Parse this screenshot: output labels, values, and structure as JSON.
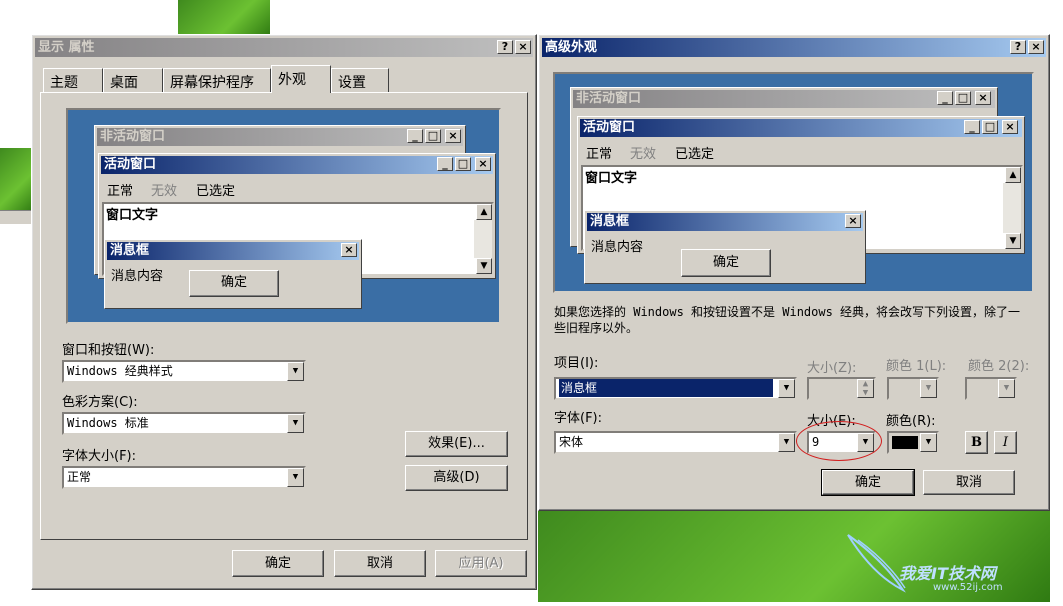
{
  "display_props": {
    "title": "显示 属性",
    "help": "?",
    "close": "×",
    "tabs": [
      "主题",
      "桌面",
      "屏幕保护程序",
      "外观",
      "设置"
    ],
    "preview": {
      "inactive_title": "非活动窗口",
      "active_title": "活动窗口",
      "menu": [
        "正常",
        "无效",
        "已选定"
      ],
      "window_text": "窗口文字",
      "msg_title": "消息框",
      "msg_text": "消息内容",
      "msg_ok": "确定"
    },
    "windows_label": "窗口和按钮(W):",
    "windows_value": "Windows 经典样式",
    "scheme_label": "色彩方案(C):",
    "scheme_value": "Windows 标准",
    "fontsize_label": "字体大小(F):",
    "fontsize_value": "正常",
    "effects_btn": "效果(E)...",
    "advanced_btn": "高级(D)",
    "ok": "确定",
    "cancel": "取消",
    "apply": "应用(A)"
  },
  "advanced": {
    "title": "高级外观",
    "help": "?",
    "close": "×",
    "preview": {
      "inactive_title": "非活动窗口",
      "active_title": "活动窗口",
      "menu": [
        "正常",
        "无效",
        "已选定"
      ],
      "window_text": "窗口文字",
      "msg_title": "消息框",
      "msg_text": "消息内容",
      "msg_ok": "确定"
    },
    "note": "如果您选择的 Windows 和按钮设置不是 Windows 经典，将会改写下列设置，除了一些旧程序以外。",
    "item_label": "项目(I):",
    "item_value": "消息框",
    "size1_label": "大小(Z):",
    "color1_label": "颜色 1(L):",
    "color2_label": "颜色 2(2):",
    "font_label": "字体(F):",
    "font_value": "宋体",
    "size2_label": "大小(E):",
    "size2_value": "9",
    "fcolor_label": "颜色(R):",
    "bold": "B",
    "italic": "I",
    "ok": "确定",
    "cancel": "取消"
  },
  "watermark": "我爱IT技术网",
  "watermark_url": "www.52ij.com"
}
